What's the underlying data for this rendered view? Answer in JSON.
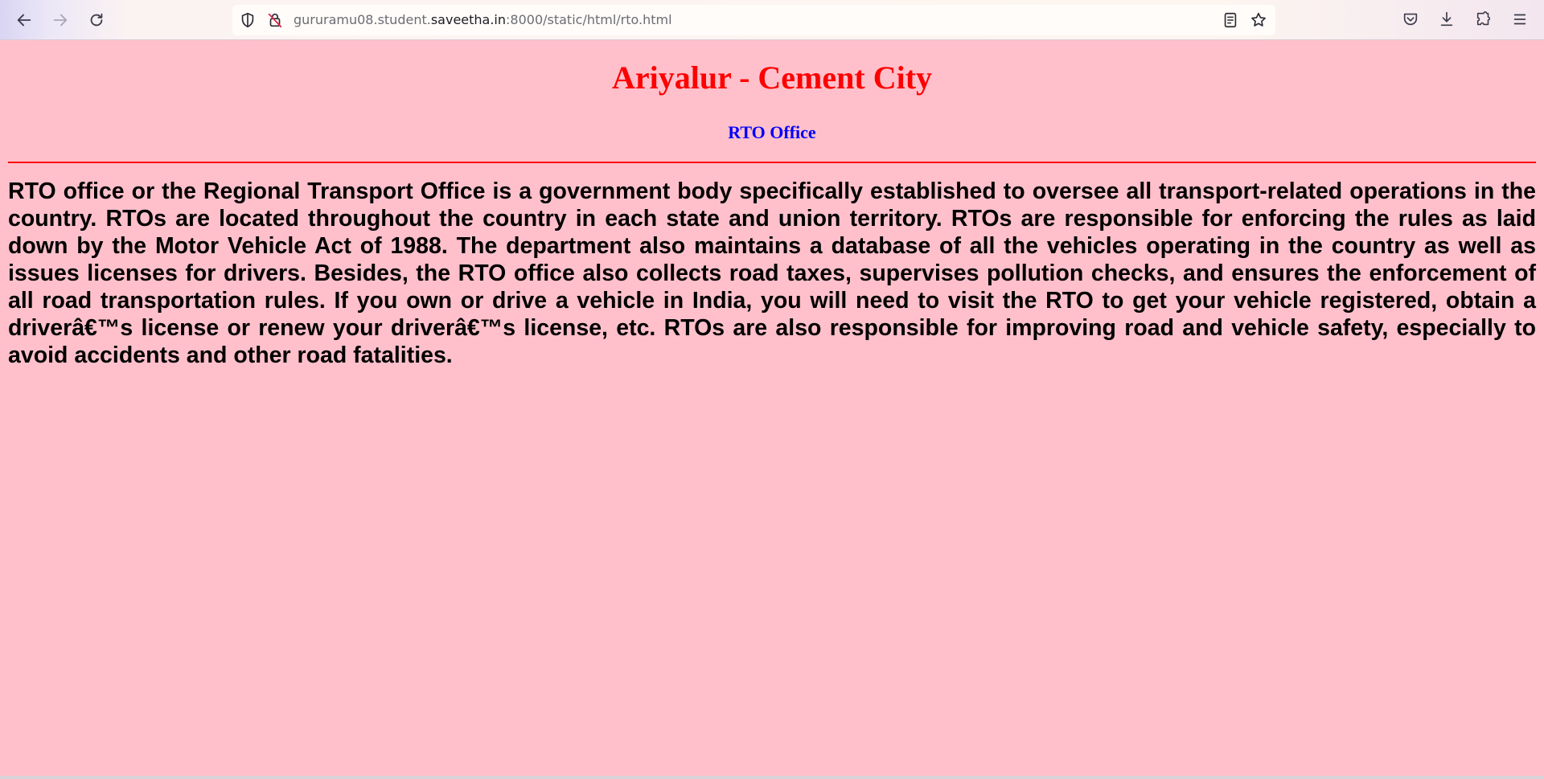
{
  "browser": {
    "url_prefix": "gururamu08.student.",
    "url_host": "saveetha.in",
    "url_suffix": ":8000/static/html/rto.html",
    "icons": {
      "back": "back-arrow-icon",
      "forward": "forward-arrow-icon",
      "reload": "reload-icon",
      "shield": "tracking-protection-shield-icon",
      "insecure": "insecure-lock-icon",
      "reader": "reader-view-icon",
      "bookmark": "bookmark-star-icon",
      "pocket": "pocket-icon",
      "downloads": "downloads-icon",
      "extensions": "extensions-icon",
      "menu": "hamburger-menu-icon"
    }
  },
  "page": {
    "title": "Ariyalur - Cement City",
    "subtitle": "RTO Office",
    "body": "RTO office or the Regional Transport Office is a government body specifically established to oversee all transport-related operations in the country. RTOs are located throughout the country in each state and union territory. RTOs are responsible for enforcing the rules as laid down by the Motor Vehicle Act of 1988. The department also maintains a database of all the vehicles operating in the country as well as issues licenses for drivers. Besides, the RTO office also collects road taxes, supervises pollution checks, and ensures the enforcement of all road transportation rules. If you own or drive a vehicle in India, you will need to visit the RTO to get your vehicle registered, obtain a driverâ€™s license or renew your driverâ€™s license, etc. RTOs are also responsible for improving road and vehicle safety, especially to avoid accidents and other road fatalities."
  },
  "colors": {
    "background": "#ffc0cb",
    "title": "#ff0000",
    "subtitle": "#0000ff",
    "divider": "#ff0000",
    "body_text": "#000000"
  }
}
